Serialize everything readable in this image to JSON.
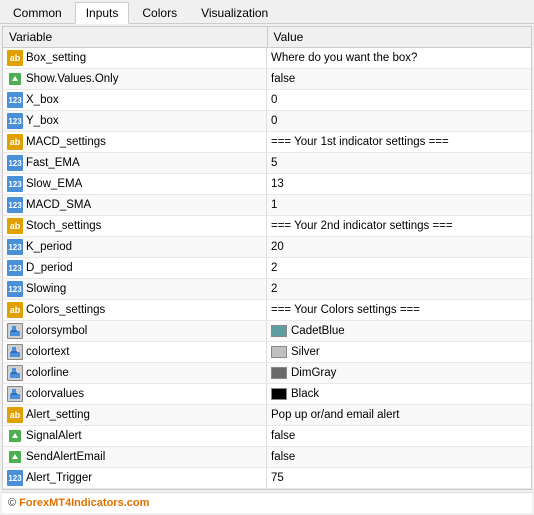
{
  "tabs": [
    {
      "label": "Common",
      "active": false
    },
    {
      "label": "Inputs",
      "active": true
    },
    {
      "label": "Colors",
      "active": false
    },
    {
      "label": "Visualization",
      "active": false
    }
  ],
  "table": {
    "col1": "Variable",
    "col2": "Value",
    "rows": [
      {
        "icon": "ab",
        "name": "Box_setting",
        "value": "Where do you want the box?",
        "type": "text"
      },
      {
        "icon": "arrow",
        "name": "Show.Values.Only",
        "value": "false",
        "type": "text"
      },
      {
        "icon": "123",
        "name": "X_box",
        "value": "0",
        "type": "text"
      },
      {
        "icon": "123",
        "name": "Y_box",
        "value": "0",
        "type": "text"
      },
      {
        "icon": "ab",
        "name": "MACD_settings",
        "value": "=== Your 1st indicator settings ===",
        "type": "text"
      },
      {
        "icon": "123",
        "name": "Fast_EMA",
        "value": "5",
        "type": "text"
      },
      {
        "icon": "123",
        "name": "Slow_EMA",
        "value": "13",
        "type": "text"
      },
      {
        "icon": "123",
        "name": "MACD_SMA",
        "value": "1",
        "type": "text"
      },
      {
        "icon": "ab",
        "name": "Stoch_settings",
        "value": "=== Your 2nd indicator settings ===",
        "type": "text"
      },
      {
        "icon": "123",
        "name": "K_period",
        "value": "20",
        "type": "text"
      },
      {
        "icon": "123",
        "name": "D_period",
        "value": "2",
        "type": "text"
      },
      {
        "icon": "123",
        "name": "Slowing",
        "value": "2",
        "type": "text"
      },
      {
        "icon": "ab",
        "name": "Colors_settings",
        "value": "=== Your Colors settings ===",
        "type": "text"
      },
      {
        "icon": "color",
        "name": "colorsymbol",
        "value": "CadetBlue",
        "color": "#5f9ea0",
        "type": "color"
      },
      {
        "icon": "color",
        "name": "colortext",
        "value": "Silver",
        "color": "#c0c0c0",
        "type": "color"
      },
      {
        "icon": "color",
        "name": "colorline",
        "value": "DimGray",
        "color": "#696969",
        "type": "color"
      },
      {
        "icon": "color",
        "name": "colorvalues",
        "value": "Black",
        "color": "#000000",
        "type": "color"
      },
      {
        "icon": "ab",
        "name": "Alert_setting",
        "value": "Pop up or/and email alert",
        "type": "text"
      },
      {
        "icon": "arrow",
        "name": "SignalAlert",
        "value": "false",
        "type": "text"
      },
      {
        "icon": "arrow",
        "name": "SendAlertEmail",
        "value": "false",
        "type": "text"
      },
      {
        "icon": "123",
        "name": "Alert_Trigger",
        "value": "75",
        "type": "text"
      }
    ]
  },
  "footer": "© ForexMT4Indicators.com"
}
